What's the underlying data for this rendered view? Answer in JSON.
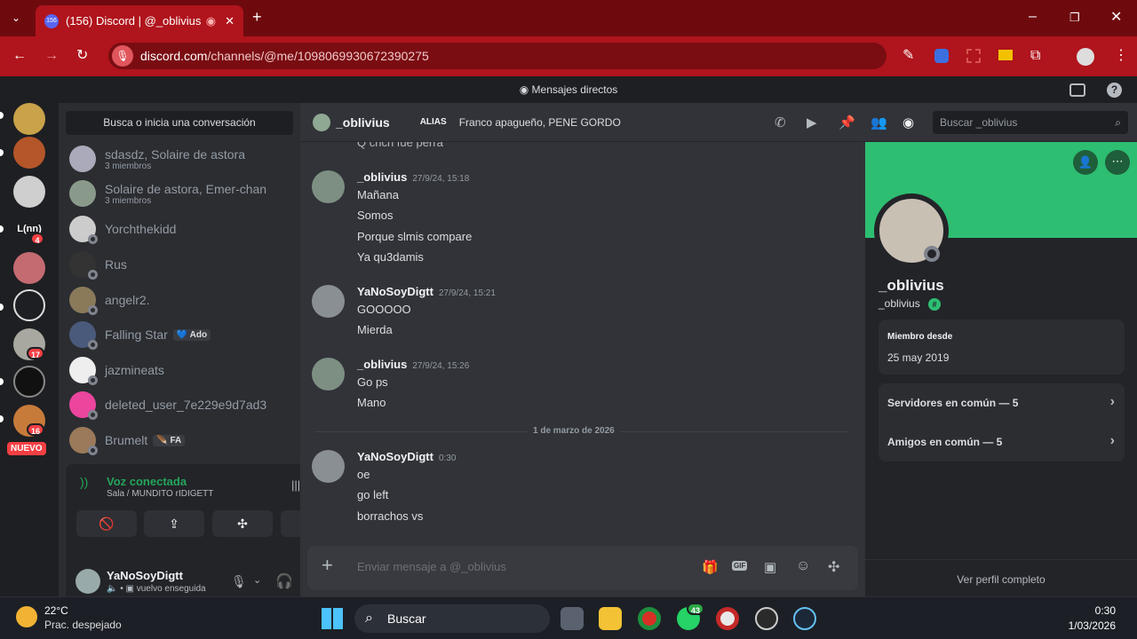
{
  "browser": {
    "tab_title": "(156) Discord | @_oblivius",
    "tab_badge": "156",
    "url_host": "discord.com",
    "url_path": "/channels/@me/1098069930672390275"
  },
  "discord": {
    "title": "Mensajes directos",
    "dm_search": "Busca o inicia una conversación",
    "dms": [
      {
        "name": "sdasdz, Solaire de astora",
        "sub": "3 miembros"
      },
      {
        "name": "Solaire de astora, Emer-chan",
        "sub": "3 miembros"
      },
      {
        "name": "Yorchthekidd"
      },
      {
        "name": "Rus"
      },
      {
        "name": "angelr2."
      },
      {
        "name": "Falling Star",
        "tag": "Ado"
      },
      {
        "name": "jazmineats"
      },
      {
        "name": "deleted_user_7e229e9d7ad3"
      },
      {
        "name": "Brumelt",
        "tag": "FA"
      }
    ],
    "rail": {
      "badges": [
        "4",
        "17",
        "16"
      ],
      "server_label": "L(nn)",
      "new_label": "NUEVO"
    },
    "voice": {
      "status": "Voz conectada",
      "channel": "Sala / MUNDITO rIDIGETT"
    },
    "user": {
      "name": "YaNoSoyDigtt",
      "status": "vuelvo enseguida"
    },
    "chat_header": {
      "name": "_oblivius",
      "alias_label": "ALIAS",
      "alias_value": "Franco apagueño, PENE GORDO",
      "search_placeholder": "Buscar _oblivius"
    },
    "partial_line": "Q chch fue perra",
    "messages": [
      {
        "author": "_oblivius",
        "time": "27/9/24, 15:18",
        "lines": [
          "Mañana",
          "Somos",
          "Porque slmis compare",
          "Ya qu3damis"
        ]
      },
      {
        "author": "YaNoSoyDigtt",
        "time": "27/9/24, 15:21",
        "lines": [
          "GOOOOO",
          "Mierda"
        ]
      },
      {
        "author": "_oblivius",
        "time": "27/9/24, 15:26",
        "lines": [
          "Go ps",
          "Mano"
        ]
      },
      {
        "author": "YaNoSoyDigtt",
        "time": "0:30",
        "lines": [
          "oe",
          "go left",
          "borrachos vs"
        ]
      }
    ],
    "date_divider": "1 de marzo de 2026",
    "composer_placeholder": "Enviar mensaje a @_oblivius",
    "profile": {
      "display_name": "_oblivius",
      "username": "_oblivius",
      "member_since_label": "Miembro desde",
      "member_since": "25 may 2019",
      "mutual_servers": "Servidores en común — 5",
      "mutual_friends": "Amigos en común — 5",
      "full_profile": "Ver perfil completo",
      "banner_color": "#2dbe72"
    }
  },
  "taskbar": {
    "temp": "22°C",
    "weather": "Prac. despejado",
    "search": "Buscar",
    "whatsapp_badge": "43",
    "time": "0:30",
    "date": "1/03/2026"
  }
}
